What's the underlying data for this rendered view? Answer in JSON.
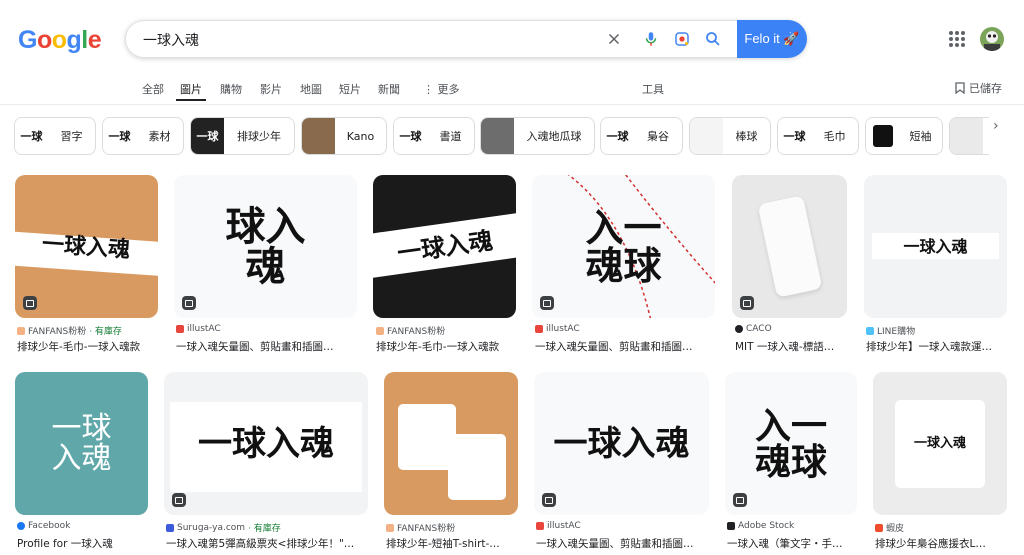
{
  "header": {
    "logo": [
      "G",
      "o",
      "o",
      "g",
      "l",
      "e"
    ],
    "logo_colors": [
      "#4285f4",
      "#ea4335",
      "#fbbc05",
      "#4285f4",
      "#34a853",
      "#ea4335"
    ],
    "query": "一球入魂",
    "felo_button": "Felo it 🚀"
  },
  "tabs": [
    {
      "label": "全部"
    },
    {
      "label": "圖片"
    },
    {
      "label": "購物"
    },
    {
      "label": "影片"
    },
    {
      "label": "地圖"
    },
    {
      "label": "短片"
    },
    {
      "label": "新聞"
    },
    {
      "label": "⋮ 更多"
    }
  ],
  "tools": "工具",
  "saved": "已儲存",
  "chips": [
    {
      "label": "習字",
      "thumb": "一球"
    },
    {
      "label": "素材",
      "thumb": "一球"
    },
    {
      "label": "排球少年",
      "thumb": "一球"
    },
    {
      "label": "Kano",
      "thumb": ""
    },
    {
      "label": "書道",
      "thumb": "一球"
    },
    {
      "label": "入魂地瓜球",
      "thumb": ""
    },
    {
      "label": "梟谷",
      "thumb": "一球"
    },
    {
      "label": "棒球",
      "thumb": ""
    },
    {
      "label": "毛巾",
      "thumb": "一球"
    },
    {
      "label": "短袖",
      "thumb": ""
    }
  ],
  "results": [
    {
      "source": "FANFANS粉粉",
      "stock": "· 有庫存",
      "title": "排球少年-毛巾-一球入魂款",
      "art": "一球入魂",
      "favicon": "#f4b183",
      "bg": "#d99a61"
    },
    {
      "source": "illustAC",
      "stock": "",
      "title": "一球入魂矢量圖、剪貼畫和插圖…",
      "art": "球入魂",
      "favicon": "#e8453c",
      "bg": "#f8f9fa"
    },
    {
      "source": "FANFANS粉粉",
      "stock": "",
      "title": "排球少年-毛巾-一球入魂款",
      "art": "一球入魂",
      "favicon": "#f4b183",
      "bg": "#1a1a1a"
    },
    {
      "source": "illustAC",
      "stock": "",
      "title": "一球入魂矢量圖、剪貼畫和插圖…",
      "art": "入一 魂球",
      "favicon": "#e8453c",
      "bg": "#f8f9fa"
    },
    {
      "source": "CACO",
      "stock": "",
      "title": "MIT 一球入魂-標語…",
      "art": "",
      "favicon": "#202124",
      "bg": "#e8e8e8"
    },
    {
      "source": "LINE購物",
      "stock": "",
      "title": "排球少年】一球入魂款運…",
      "art": "一球入魂",
      "favicon": "#4fc3f7",
      "bg": "#f1f3f4"
    },
    {
      "source": "Facebook",
      "stock": "",
      "title": "Profile for 一球入魂",
      "art": "一球 入魂",
      "favicon": "#1877f2",
      "bg": "#5fa7a8"
    },
    {
      "source": "Suruga-ya.com",
      "stock": "· 有庫存",
      "title": "一球入魂第5彈高級票夾<排球少年！\"…",
      "art": "一球入魂",
      "favicon": "#3b5bdb",
      "bg": "#f1f3f4"
    },
    {
      "source": "FANFANS粉粉",
      "stock": "",
      "title": "排球少年-短袖T-shirt-…",
      "art": "",
      "favicon": "#f4b183",
      "bg": "#d99a61"
    },
    {
      "source": "illustAC",
      "stock": "",
      "title": "一球入魂矢量圖、剪貼畫和插圖…",
      "art": "一球入魂",
      "favicon": "#e8453c",
      "bg": "#f8f9fa"
    },
    {
      "source": "Adobe Stock",
      "stock": "",
      "title": "一球入魂（筆文字・手…",
      "art": "入一 魂球",
      "favicon": "#202124",
      "bg": "#f8f9fa"
    },
    {
      "source": "蝦皮",
      "stock": "",
      "title": "排球少年梟谷應援衣L…",
      "art": "一球入魂",
      "favicon": "#ee4d2d",
      "bg": "#ececec"
    }
  ],
  "colors": {
    "accent": "#1a73e8",
    "felo": "#3b82f6",
    "stock_green": "#188038"
  }
}
